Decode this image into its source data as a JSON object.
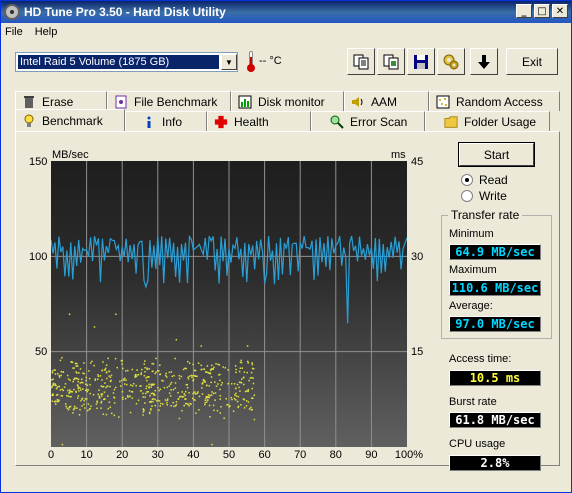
{
  "window": {
    "title": "HD Tune Pro 3.50 - Hard Disk Utility",
    "buttons": [
      "_",
      "□",
      "✕"
    ]
  },
  "menu": [
    "File",
    "Help"
  ],
  "toolbar": {
    "drive": "Intel   Raid 5 Volume (1875 GB)",
    "temperature": "-- °C",
    "exit_label": "Exit"
  },
  "tabs_top": [
    {
      "label": "Erase",
      "icon": "trash-icon"
    },
    {
      "label": "File Benchmark",
      "icon": "file-benchmark-icon"
    },
    {
      "label": "Disk monitor",
      "icon": "disk-monitor-icon"
    },
    {
      "label": "AAM",
      "icon": "speaker-icon"
    },
    {
      "label": "Random Access",
      "icon": "random-access-icon"
    }
  ],
  "tabs_bottom": [
    {
      "label": "Benchmark",
      "icon": "lightbulb-icon"
    },
    {
      "label": "Info",
      "icon": "info-icon"
    },
    {
      "label": "Health",
      "icon": "health-cross-icon"
    },
    {
      "label": "Error Scan",
      "icon": "magnifier-icon"
    },
    {
      "label": "Folder Usage",
      "icon": "folder-icon"
    }
  ],
  "chart": {
    "left_unit": "MB/sec",
    "right_unit": "ms",
    "left_ticks": [
      "150",
      "100",
      "50"
    ],
    "right_ticks": [
      "45",
      "30",
      "15"
    ],
    "x_ticks": [
      "0",
      "10",
      "20",
      "30",
      "40",
      "50",
      "60",
      "70",
      "80",
      "90",
      "100%"
    ]
  },
  "chart_data": {
    "type": "line",
    "xlabel": "",
    "ylabel": "MB/sec",
    "x_range": [
      0,
      100
    ],
    "y_range": [
      0,
      150
    ],
    "y2_range": [
      0,
      45
    ],
    "series": [
      {
        "name": "",
        "axis": "left",
        "style": "line",
        "mean": 97.0,
        "min": 64.9,
        "max": 110.6
      },
      {
        "name": "",
        "axis": "right",
        "style": "scatter",
        "x_range": [
          0,
          57
        ],
        "y_range": [
          0,
          15
        ]
      }
    ],
    "colors": {
      "transfer": "#2a9fd6",
      "access": "#e0e040"
    },
    "grid": true
  },
  "controls": {
    "start_label": "Start",
    "read_label": "Read",
    "write_label": "Write",
    "selected": "Read"
  },
  "stats": {
    "transfer_rate_title": "Transfer rate",
    "minimum_label": "Minimum",
    "minimum_value": "64.9 MB/sec",
    "maximum_label": "Maximum",
    "maximum_value": "110.6 MB/sec",
    "average_label": "Average:",
    "average_value": "97.0 MB/sec",
    "access_time_label": "Access time:",
    "access_time_value": "10.5 ms",
    "burst_rate_label": "Burst rate",
    "burst_rate_value": "61.8 MB/sec",
    "cpu_usage_label": "CPU usage",
    "cpu_usage_value": "2.8%"
  },
  "value_colors": {
    "transfer": "#00d8ff",
    "access": "#ffff40",
    "burst": "#ffffff",
    "cpu": "#ffffff"
  }
}
